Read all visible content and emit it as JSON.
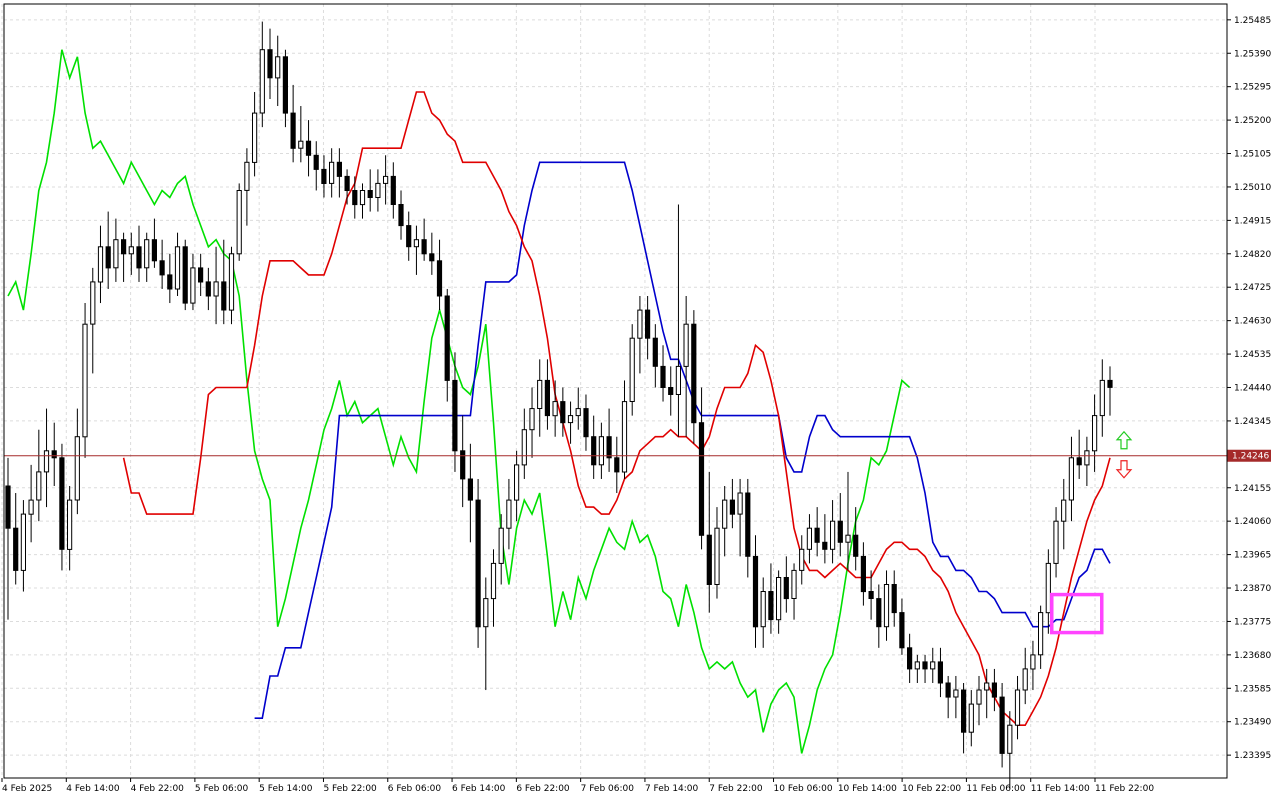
{
  "colors": {
    "background": "#ffffff",
    "grid": "#dcdcdc",
    "axis": "#000000",
    "bull_candle": "#000000",
    "bear_candle": "#000000",
    "tenkan": "#e00000",
    "kijun": "#0000cc",
    "chikou": "#00e000",
    "price_line": "#a52a2a",
    "highlight": "#ff44ff",
    "arrow_up": "#22cc22",
    "arrow_down": "#ee2222"
  },
  "chart_data": {
    "type": "candlestick",
    "symbol_current_price": "1.24246",
    "current_price": 1.24246,
    "ylim": [
      1.2333,
      1.2553
    ],
    "y_ticks": [
      "1.25485",
      "1.25390",
      "1.25295",
      "1.25200",
      "1.25105",
      "1.25010",
      "1.24915",
      "1.24820",
      "1.24725",
      "1.24630",
      "1.24535",
      "1.24440",
      "1.24345",
      "1.24155",
      "1.24060",
      "1.23965",
      "1.23870",
      "1.23775",
      "1.23680",
      "1.23585",
      "1.23490",
      "1.23395"
    ],
    "x_ticks": [
      "4 Feb 2025",
      "4 Feb 14:00",
      "4 Feb 22:00",
      "5 Feb 06:00",
      "5 Feb 14:00",
      "5 Feb 22:00",
      "6 Feb 06:00",
      "6 Feb 14:00",
      "6 Feb 22:00",
      "7 Feb 06:00",
      "7 Feb 14:00",
      "7 Feb 22:00",
      "10 Feb 06:00",
      "10 Feb 14:00",
      "10 Feb 22:00",
      "11 Feb 06:00",
      "11 Feb 14:00",
      "11 Feb 22:00"
    ],
    "candles": [
      [
        1.2416,
        1.2424,
        1.2378,
        1.2404
      ],
      [
        1.2404,
        1.2414,
        1.2388,
        1.2392
      ],
      [
        1.2392,
        1.2412,
        1.2386,
        1.2408
      ],
      [
        1.2408,
        1.2422,
        1.24,
        1.2412
      ],
      [
        1.2412,
        1.2432,
        1.2406,
        1.242
      ],
      [
        1.242,
        1.2438,
        1.241,
        1.2426
      ],
      [
        1.2426,
        1.2434,
        1.2416,
        1.2424
      ],
      [
        1.2424,
        1.2428,
        1.2392,
        1.2398
      ],
      [
        1.2398,
        1.2416,
        1.2392,
        1.2412
      ],
      [
        1.2412,
        1.2438,
        1.2408,
        1.243
      ],
      [
        1.243,
        1.2468,
        1.2424,
        1.2462
      ],
      [
        1.2462,
        1.2478,
        1.2448,
        1.2474
      ],
      [
        1.2474,
        1.249,
        1.2468,
        1.2484
      ],
      [
        1.2484,
        1.2494,
        1.2472,
        1.2478
      ],
      [
        1.2478,
        1.2492,
        1.2474,
        1.2486
      ],
      [
        1.2486,
        1.2488,
        1.2474,
        1.2482
      ],
      [
        1.2482,
        1.2488,
        1.2476,
        1.2484
      ],
      [
        1.2484,
        1.249,
        1.2474,
        1.2478
      ],
      [
        1.2478,
        1.2488,
        1.2474,
        1.2486
      ],
      [
        1.2486,
        1.2492,
        1.2478,
        1.248
      ],
      [
        1.248,
        1.2486,
        1.2472,
        1.2476
      ],
      [
        1.2476,
        1.2482,
        1.2468,
        1.2472
      ],
      [
        1.2472,
        1.2488,
        1.247,
        1.2484
      ],
      [
        1.2484,
        1.2486,
        1.2466,
        1.2468
      ],
      [
        1.2468,
        1.2482,
        1.2466,
        1.2478
      ],
      [
        1.2478,
        1.2482,
        1.247,
        1.2474
      ],
      [
        1.2474,
        1.2478,
        1.2466,
        1.247
      ],
      [
        1.247,
        1.2484,
        1.2462,
        1.2474
      ],
      [
        1.2474,
        1.2486,
        1.2462,
        1.2466
      ],
      [
        1.2466,
        1.2484,
        1.2462,
        1.2482
      ],
      [
        1.2482,
        1.2502,
        1.248,
        1.25
      ],
      [
        1.25,
        1.2512,
        1.249,
        1.2508
      ],
      [
        1.2508,
        1.2528,
        1.2504,
        1.2522
      ],
      [
        1.2522,
        1.2548,
        1.2518,
        1.254
      ],
      [
        1.254,
        1.2546,
        1.2526,
        1.2532
      ],
      [
        1.2532,
        1.2544,
        1.2524,
        1.2538
      ],
      [
        1.2538,
        1.254,
        1.2518,
        1.2522
      ],
      [
        1.2522,
        1.253,
        1.2508,
        1.2512
      ],
      [
        1.2512,
        1.2524,
        1.2508,
        1.2514
      ],
      [
        1.2514,
        1.252,
        1.2504,
        1.251
      ],
      [
        1.251,
        1.2514,
        1.25,
        1.2506
      ],
      [
        1.2506,
        1.251,
        1.2498,
        1.2502
      ],
      [
        1.2502,
        1.2512,
        1.2498,
        1.2508
      ],
      [
        1.2508,
        1.2512,
        1.2498,
        1.2504
      ],
      [
        1.2504,
        1.2506,
        1.2496,
        1.25
      ],
      [
        1.25,
        1.2504,
        1.2492,
        1.2496
      ],
      [
        1.2496,
        1.2502,
        1.2492,
        1.25
      ],
      [
        1.25,
        1.2506,
        1.2494,
        1.2498
      ],
      [
        1.2498,
        1.2506,
        1.2494,
        1.2502
      ],
      [
        1.2502,
        1.251,
        1.2496,
        1.2504
      ],
      [
        1.2504,
        1.2508,
        1.2492,
        1.2496
      ],
      [
        1.2496,
        1.25,
        1.2486,
        1.249
      ],
      [
        1.249,
        1.2494,
        1.248,
        1.2484
      ],
      [
        1.2484,
        1.249,
        1.2476,
        1.2486
      ],
      [
        1.2486,
        1.2492,
        1.248,
        1.2482
      ],
      [
        1.2482,
        1.2488,
        1.2476,
        1.248
      ],
      [
        1.248,
        1.2486,
        1.2466,
        1.247
      ],
      [
        1.247,
        1.2472,
        1.244,
        1.2446
      ],
      [
        1.2446,
        1.2454,
        1.242,
        1.2426
      ],
      [
        1.2426,
        1.2436,
        1.241,
        1.2418
      ],
      [
        1.2418,
        1.2428,
        1.24,
        1.2412
      ],
      [
        1.2412,
        1.2418,
        1.237,
        1.2376
      ],
      [
        1.2376,
        1.239,
        1.2358,
        1.2384
      ],
      [
        1.2384,
        1.2398,
        1.2376,
        1.2394
      ],
      [
        1.2394,
        1.2408,
        1.2388,
        1.2404
      ],
      [
        1.2404,
        1.2418,
        1.2398,
        1.2412
      ],
      [
        1.2412,
        1.2426,
        1.2406,
        1.2422
      ],
      [
        1.2422,
        1.2438,
        1.2418,
        1.2432
      ],
      [
        1.2432,
        1.2444,
        1.2424,
        1.2438
      ],
      [
        1.2438,
        1.2452,
        1.243,
        1.2446
      ],
      [
        1.2446,
        1.2452,
        1.2432,
        1.2436
      ],
      [
        1.2436,
        1.2446,
        1.243,
        1.244
      ],
      [
        1.244,
        1.2444,
        1.243,
        1.2434
      ],
      [
        1.2434,
        1.244,
        1.2428,
        1.2436
      ],
      [
        1.2436,
        1.2444,
        1.2432,
        1.2438
      ],
      [
        1.2438,
        1.2442,
        1.2426,
        1.243
      ],
      [
        1.243,
        1.2436,
        1.2418,
        1.2422
      ],
      [
        1.2422,
        1.2434,
        1.2418,
        1.243
      ],
      [
        1.243,
        1.2438,
        1.242,
        1.2424
      ],
      [
        1.2424,
        1.243,
        1.2414,
        1.242
      ],
      [
        1.242,
        1.2446,
        1.2418,
        1.244
      ],
      [
        1.244,
        1.2462,
        1.2436,
        1.2458
      ],
      [
        1.2458,
        1.247,
        1.2448,
        1.2466
      ],
      [
        1.2466,
        1.247,
        1.2452,
        1.2458
      ],
      [
        1.2458,
        1.2462,
        1.2444,
        1.245
      ],
      [
        1.245,
        1.2456,
        1.244,
        1.2444
      ],
      [
        1.2444,
        1.245,
        1.2436,
        1.2442
      ],
      [
        1.2442,
        1.2496,
        1.243,
        1.245
      ],
      [
        1.245,
        1.247,
        1.243,
        1.2462
      ],
      [
        1.2462,
        1.2466,
        1.2428,
        1.2434
      ],
      [
        1.2434,
        1.2444,
        1.2398,
        1.2402
      ],
      [
        1.2402,
        1.242,
        1.238,
        1.2388
      ],
      [
        1.2388,
        1.241,
        1.2384,
        1.2404
      ],
      [
        1.2404,
        1.2416,
        1.2396,
        1.2412
      ],
      [
        1.2412,
        1.2418,
        1.2404,
        1.2408
      ],
      [
        1.2408,
        1.2418,
        1.2396,
        1.2414
      ],
      [
        1.2414,
        1.2418,
        1.239,
        1.2396
      ],
      [
        1.2396,
        1.2402,
        1.237,
        1.2376
      ],
      [
        1.2376,
        1.239,
        1.237,
        1.2386
      ],
      [
        1.2386,
        1.2394,
        1.2374,
        1.2378
      ],
      [
        1.2378,
        1.2392,
        1.2374,
        1.239
      ],
      [
        1.239,
        1.2396,
        1.238,
        1.2384
      ],
      [
        1.2384,
        1.2394,
        1.2378,
        1.2392
      ],
      [
        1.2392,
        1.2402,
        1.2388,
        1.2398
      ],
      [
        1.2398,
        1.2408,
        1.2394,
        1.2404
      ],
      [
        1.2404,
        1.241,
        1.2396,
        1.24
      ],
      [
        1.24,
        1.2408,
        1.2394,
        1.2398
      ],
      [
        1.2398,
        1.2412,
        1.2394,
        1.2406
      ],
      [
        1.2406,
        1.2414,
        1.2396,
        1.24
      ],
      [
        1.24,
        1.242,
        1.2392,
        1.2402
      ],
      [
        1.2402,
        1.241,
        1.2392,
        1.2396
      ],
      [
        1.2396,
        1.24,
        1.2382,
        1.2386
      ],
      [
        1.2386,
        1.2392,
        1.2378,
        1.2384
      ],
      [
        1.2384,
        1.2388,
        1.237,
        1.2376
      ],
      [
        1.2376,
        1.2392,
        1.2372,
        1.2388
      ],
      [
        1.2388,
        1.2392,
        1.2376,
        1.238
      ],
      [
        1.238,
        1.2384,
        1.2368,
        1.237
      ],
      [
        1.237,
        1.2374,
        1.236,
        1.2364
      ],
      [
        1.2364,
        1.2368,
        1.236,
        1.2366
      ],
      [
        1.2366,
        1.2368,
        1.236,
        1.2364
      ],
      [
        1.2364,
        1.237,
        1.236,
        1.2366
      ],
      [
        1.2366,
        1.237,
        1.2356,
        1.236
      ],
      [
        1.236,
        1.2362,
        1.235,
        1.2356
      ],
      [
        1.2356,
        1.2362,
        1.235,
        1.2358
      ],
      [
        1.2358,
        1.236,
        1.234,
        1.2346
      ],
      [
        1.2346,
        1.2358,
        1.2342,
        1.2354
      ],
      [
        1.2354,
        1.2362,
        1.2348,
        1.2358
      ],
      [
        1.2358,
        1.2364,
        1.235,
        1.236
      ],
      [
        1.236,
        1.2364,
        1.2352,
        1.2356
      ],
      [
        1.2356,
        1.236,
        1.2336,
        1.234
      ],
      [
        1.234,
        1.2352,
        1.233,
        1.2348
      ],
      [
        1.2348,
        1.2362,
        1.2344,
        1.2358
      ],
      [
        1.2358,
        1.237,
        1.2354,
        1.2364
      ],
      [
        1.2364,
        1.2372,
        1.2358,
        1.2368
      ],
      [
        1.2368,
        1.2382,
        1.2364,
        1.238
      ],
      [
        1.238,
        1.2398,
        1.2374,
        1.2394
      ],
      [
        1.2394,
        1.241,
        1.239,
        1.2406
      ],
      [
        1.2406,
        1.2418,
        1.2398,
        1.2412
      ],
      [
        1.2412,
        1.243,
        1.2406,
        1.2424
      ],
      [
        1.2424,
        1.2432,
        1.2418,
        1.2422
      ],
      [
        1.2422,
        1.243,
        1.2416,
        1.2426
      ],
      [
        1.2426,
        1.2442,
        1.242,
        1.2436
      ],
      [
        1.2436,
        1.2452,
        1.243,
        1.2446
      ],
      [
        1.2446,
        1.245,
        1.2436,
        1.2444
      ]
    ],
    "tenkan": [
      1.2424,
      1.2414,
      1.2414,
      1.2408,
      1.2408,
      1.2408,
      1.2408,
      1.2408,
      1.2408,
      1.2408,
      1.2424,
      1.2442,
      1.2444,
      1.2444,
      1.2444,
      1.2444,
      1.2444,
      1.2456,
      1.247,
      1.248,
      1.248,
      1.248,
      1.248,
      1.2478,
      1.2476,
      1.2476,
      1.2476,
      1.2482,
      1.249,
      1.2498,
      1.2502,
      1.2512,
      1.2512,
      1.2512,
      1.2512,
      1.2512,
      1.2512,
      1.252,
      1.2528,
      1.2528,
      1.2522,
      1.252,
      1.2516,
      1.2514,
      1.2508,
      1.2508,
      1.2508,
      1.2508,
      1.2504,
      1.25,
      1.2494,
      1.249,
      1.2484,
      1.248,
      1.247,
      1.2458,
      1.2442,
      1.2434,
      1.2426,
      1.2416,
      1.241,
      1.241,
      1.2408,
      1.2408,
      1.2412,
      1.2418,
      1.242,
      1.2426,
      1.2428,
      1.243,
      1.243,
      1.2432,
      1.243,
      1.243,
      1.2428,
      1.2426,
      1.243,
      1.2438,
      1.2444,
      1.2444,
      1.2444,
      1.2448,
      1.2456,
      1.2454,
      1.2446,
      1.2436,
      1.242,
      1.2404,
      1.2396,
      1.2392,
      1.2392,
      1.239,
      1.2392,
      1.2394,
      1.2392,
      1.239,
      1.239,
      1.239,
      1.2394,
      1.2398,
      1.24,
      1.24,
      1.2398,
      1.2398,
      1.2396,
      1.2392,
      1.239,
      1.2386,
      1.238,
      1.2376,
      1.2372,
      1.2368,
      1.236,
      1.2356,
      1.2352,
      1.235,
      1.2348,
      1.2348,
      1.2352,
      1.2356,
      1.2362,
      1.237,
      1.238,
      1.239,
      1.2398,
      1.2406,
      1.2412,
      1.2416,
      1.2424
    ],
    "kijun": [
      1.235,
      1.235,
      1.2362,
      1.2362,
      1.237,
      1.237,
      1.237,
      1.238,
      1.239,
      1.24,
      1.241,
      1.2436,
      1.2436,
      1.2436,
      1.2436,
      1.2436,
      1.2436,
      1.2436,
      1.2436,
      1.2436,
      1.2436,
      1.2436,
      1.2436,
      1.2436,
      1.2436,
      1.2436,
      1.2436,
      1.2436,
      1.2436,
      1.2456,
      1.2474,
      1.2474,
      1.2474,
      1.2474,
      1.2476,
      1.249,
      1.25,
      1.2508,
      1.2508,
      1.2508,
      1.2508,
      1.2508,
      1.2508,
      1.2508,
      1.2508,
      1.2508,
      1.2508,
      1.2508,
      1.2508,
      1.25,
      1.249,
      1.248,
      1.247,
      1.246,
      1.2452,
      1.2452,
      1.2446,
      1.244,
      1.2436,
      1.2436,
      1.2436,
      1.2436,
      1.2436,
      1.2436,
      1.2436,
      1.2436,
      1.2436,
      1.2436,
      1.2436,
      1.2424,
      1.242,
      1.242,
      1.243,
      1.2436,
      1.2436,
      1.2432,
      1.243,
      1.243,
      1.243,
      1.243,
      1.243,
      1.243,
      1.243,
      1.243,
      1.243,
      1.243,
      1.2424,
      1.2414,
      1.24,
      1.2396,
      1.2396,
      1.2392,
      1.2392,
      1.239,
      1.2386,
      1.2386,
      1.2384,
      1.238,
      1.238,
      1.238,
      1.238,
      1.2376,
      1.2376,
      1.2376,
      1.2378,
      1.2378,
      1.2384,
      1.239,
      1.2392,
      1.2398,
      1.2398,
      1.2394
    ]
  }
}
